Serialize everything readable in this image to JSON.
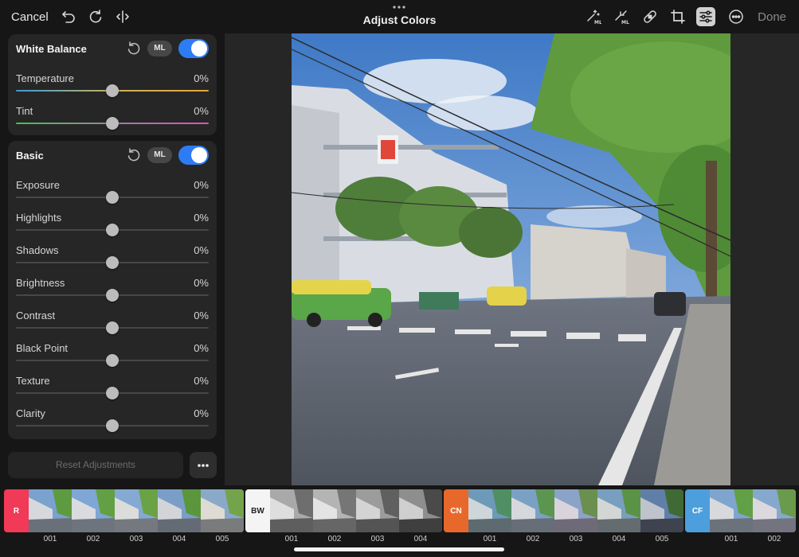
{
  "topbar": {
    "cancel_label": "Cancel",
    "title": "Adjust Colors",
    "done_label": "Done"
  },
  "panels": {
    "white_balance": {
      "title": "White Balance",
      "ml_label": "ML",
      "enabled": true,
      "sliders": [
        {
          "label": "Temperature",
          "value": "0%"
        },
        {
          "label": "Tint",
          "value": "0%"
        }
      ]
    },
    "basic": {
      "title": "Basic",
      "ml_label": "ML",
      "enabled": true,
      "sliders": [
        {
          "label": "Exposure",
          "value": "0%"
        },
        {
          "label": "Highlights",
          "value": "0%"
        },
        {
          "label": "Shadows",
          "value": "0%"
        },
        {
          "label": "Brightness",
          "value": "0%"
        },
        {
          "label": "Contrast",
          "value": "0%"
        },
        {
          "label": "Black Point",
          "value": "0%"
        },
        {
          "label": "Texture",
          "value": "0%"
        },
        {
          "label": "Clarity",
          "value": "0%"
        }
      ]
    }
  },
  "footer": {
    "reset_label": "Reset Adjustments"
  },
  "filmstrip": {
    "groups": [
      {
        "badge": "R",
        "color": "#f03a57",
        "text_color": "#ffffff",
        "items": [
          "001",
          "002",
          "003",
          "004",
          "005"
        ]
      },
      {
        "badge": "BW",
        "color": "#f4f4f4",
        "text_color": "#222222",
        "items": [
          "001",
          "002",
          "003",
          "004"
        ]
      },
      {
        "badge": "CN",
        "color": "#e8682c",
        "text_color": "#ffffff",
        "items": [
          "001",
          "002",
          "003",
          "004",
          "005"
        ]
      },
      {
        "badge": "CF",
        "color": "#4c9fdc",
        "text_color": "#ffffff",
        "items": [
          "001",
          "002"
        ]
      }
    ]
  },
  "colors": {
    "accent": "#2d7cf6",
    "toggle_knob": "#ffffff"
  },
  "icons": [
    "undo-icon",
    "redo-icon",
    "compare-icon",
    "ml-wand-icon",
    "ml-auto-icon",
    "heal-icon",
    "crop-icon",
    "adjust-icon",
    "more-icon"
  ]
}
